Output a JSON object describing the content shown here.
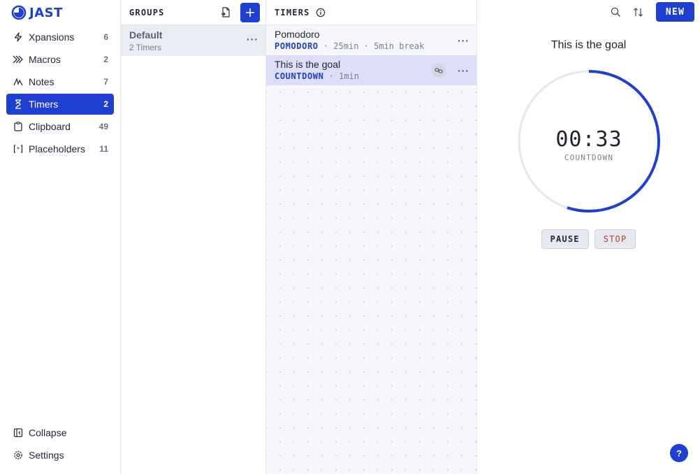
{
  "app": {
    "logo_text": "JAST",
    "accent_color": "#1e3fcf"
  },
  "sidebar": {
    "items": [
      {
        "label": "Xpansions",
        "count": "6",
        "icon": "bolt-icon"
      },
      {
        "label": "Macros",
        "count": "2",
        "icon": "chevrons-right-icon"
      },
      {
        "label": "Notes",
        "count": "7",
        "icon": "pen-icon"
      },
      {
        "label": "Timers",
        "count": "2",
        "icon": "hourglass-icon",
        "active": true
      },
      {
        "label": "Clipboard",
        "count": "49",
        "icon": "clipboard-icon"
      },
      {
        "label": "Placeholders",
        "count": "11",
        "icon": "braces-icon"
      }
    ],
    "bottom": {
      "collapse_label": "Collapse",
      "settings_label": "Settings"
    }
  },
  "groups": {
    "title": "GROUPS",
    "items": [
      {
        "name": "Default",
        "subtitle": "2 Timers"
      }
    ]
  },
  "timers": {
    "title": "TIMERS",
    "items": [
      {
        "name": "Pomodoro",
        "type": "POMODORO",
        "duration": "25min",
        "break": "5min break"
      },
      {
        "name": "This is the goal",
        "type": "COUNTDOWN",
        "duration": "1min",
        "selected": true
      }
    ]
  },
  "detail": {
    "new_label": "NEW",
    "title": "This is the goal",
    "time": "00:33",
    "mode": "COUNTDOWN",
    "progress_remaining": 0.55,
    "pause_label": "PAUSE",
    "stop_label": "STOP",
    "help_label": "?"
  }
}
